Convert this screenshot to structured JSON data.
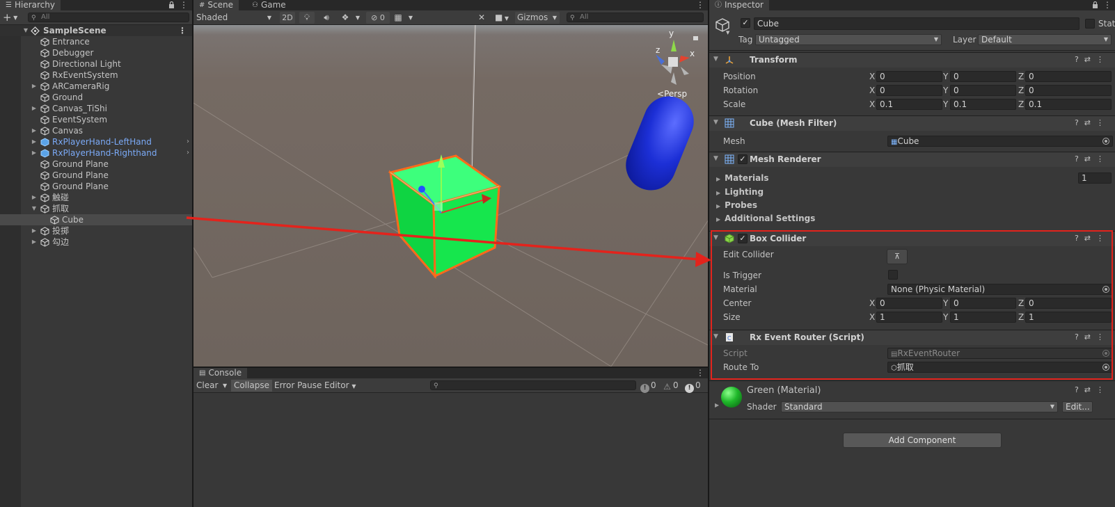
{
  "hierarchy": {
    "tab_label": "Hierarchy",
    "search_placeholder": "All",
    "scene_name": "SampleScene",
    "items": [
      {
        "label": "Entrance"
      },
      {
        "label": "Debugger"
      },
      {
        "label": "Directional Light"
      },
      {
        "label": "RxEventSystem"
      },
      {
        "label": "ARCameraRig"
      },
      {
        "label": "Ground"
      },
      {
        "label": "Canvas_TiShi"
      },
      {
        "label": "EventSystem"
      },
      {
        "label": "Canvas"
      },
      {
        "label": "RxPlayerHand-LeftHand"
      },
      {
        "label": "RxPlayerHand-Righthand"
      },
      {
        "label": "Ground Plane"
      },
      {
        "label": "Ground Plane"
      },
      {
        "label": "Ground Plane"
      },
      {
        "label": "触碰"
      },
      {
        "label": "抓取"
      },
      {
        "label": "Cube"
      },
      {
        "label": "投掷"
      },
      {
        "label": "勾边"
      }
    ]
  },
  "scene": {
    "tab_scene": "Scene",
    "tab_game": "Game",
    "shading_mode": "Shaded",
    "mode_2d": "2D",
    "hidden_count": "0",
    "gizmos_label": "Gizmos",
    "search_placeholder": "All",
    "persp_label": "Persp",
    "axis_y": "y",
    "axis_x": "x",
    "axis_z": "z"
  },
  "console": {
    "tab_label": "Console",
    "clear_label": "Clear",
    "collapse_label": "Collapse",
    "error_pause_label": "Error Pause",
    "editor_label": "Editor",
    "info_count": "0",
    "warning_count": "0",
    "error_count": "0"
  },
  "inspector": {
    "tab_label": "Inspector",
    "object_name": "Cube",
    "static_label": "Static",
    "tag_label": "Tag",
    "tag_value": "Untagged",
    "layer_label": "Layer",
    "layer_value": "Default",
    "transform": {
      "title": "Transform",
      "position_label": "Position",
      "position": [
        "0",
        "0",
        "0"
      ],
      "rotation_label": "Rotation",
      "rotation": [
        "0",
        "0",
        "0"
      ],
      "scale_label": "Scale",
      "scale": [
        "0.1",
        "0.1",
        "0.1"
      ]
    },
    "mesh_filter": {
      "title": "Cube (Mesh Filter)",
      "mesh_label": "Mesh",
      "mesh_value": "Cube"
    },
    "mesh_renderer": {
      "title": "Mesh Renderer",
      "materials_label": "Materials",
      "materials_count": "1",
      "lighting_label": "Lighting",
      "probes_label": "Probes",
      "additional_label": "Additional Settings"
    },
    "box_collider": {
      "title": "Box Collider",
      "edit_collider_label": "Edit Collider",
      "is_trigger_label": "Is Trigger",
      "material_label": "Material",
      "material_value": "None (Physic Material)",
      "center_label": "Center",
      "center": [
        "0",
        "0",
        "0"
      ],
      "size_label": "Size",
      "size": [
        "1",
        "1",
        "1"
      ]
    },
    "rx_router": {
      "title": "Rx Event Router (Script)",
      "script_label": "Script",
      "script_value": "RxEventRouter",
      "route_label": "Route To",
      "route_value": "抓取"
    },
    "material": {
      "title": "Green (Material)",
      "shader_label": "Shader",
      "shader_value": "Standard",
      "edit_label": "Edit..."
    },
    "add_component_label": "Add Component"
  },
  "colors": {
    "highlight_red": "#e3231c",
    "cube_green": "#1de04f",
    "capsule_blue": "#1c2fd6",
    "prefab_blue": "#7baaf7"
  }
}
